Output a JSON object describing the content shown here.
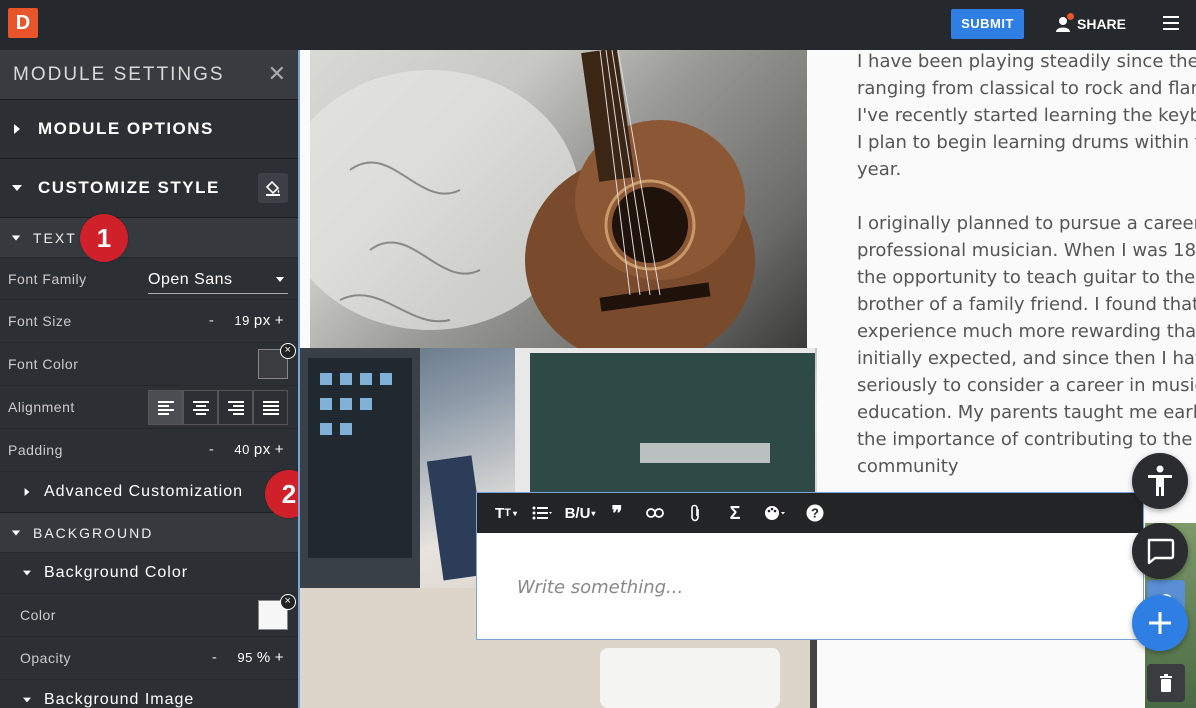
{
  "topbar": {
    "logo": "D",
    "submit_label": "SUBMIT",
    "share_label": "SHARE"
  },
  "sidebar": {
    "title": "MODULE SETTINGS",
    "module_options": "MODULE OPTIONS",
    "customize_style": "CUSTOMIZE STYLE",
    "text_section": "TEXT",
    "rows": {
      "font_family": {
        "label": "Font Family",
        "value": "Open Sans"
      },
      "font_size": {
        "label": "Font Size",
        "value": "19",
        "unit": "px"
      },
      "font_color": {
        "label": "Font Color",
        "swatch": "#3a3c3f"
      },
      "alignment": {
        "label": "Alignment",
        "selected": "left"
      },
      "padding": {
        "label": "Padding",
        "value": "40",
        "unit": "px"
      }
    },
    "advanced": "Advanced Customization",
    "background_section": "BACKGROUND",
    "background_color": "Background Color",
    "color": {
      "label": "Color",
      "swatch": "#f7f7f7"
    },
    "opacity": {
      "label": "Opacity",
      "value": "95",
      "unit": "%"
    },
    "background_image": "Background Image",
    "minus": "-",
    "plus": "+"
  },
  "badges": {
    "one": "1",
    "two": "2"
  },
  "content": {
    "paragraph": "I have been playing steadily since then\nranging from classical to rock and flam\nI've recently started learning the keybo\nI plan to begin learning drums within th\nyear.\n\nI originally planned to pursue a career\nprofessional musician. When I was 18,\nthe opportunity to teach guitar to the y\nbrother of a family friend. I found that\nexperience much more rewarding than\ninitially expected, and since then I have\nseriously to consider a career in music\neducation. My parents taught me early\nthe importance of contributing to the\ncommunity"
  },
  "editor": {
    "placeholder": "Write something...",
    "tools": [
      "text-size",
      "list",
      "bold-underline",
      "quote",
      "link",
      "attach",
      "sigma",
      "palette",
      "help"
    ],
    "bold_underline": "B/U"
  },
  "colors": {
    "accent": "#2f7ee3",
    "logo": "#e8552a",
    "badge": "#d0202a",
    "sidebar": "#2c2f33"
  }
}
